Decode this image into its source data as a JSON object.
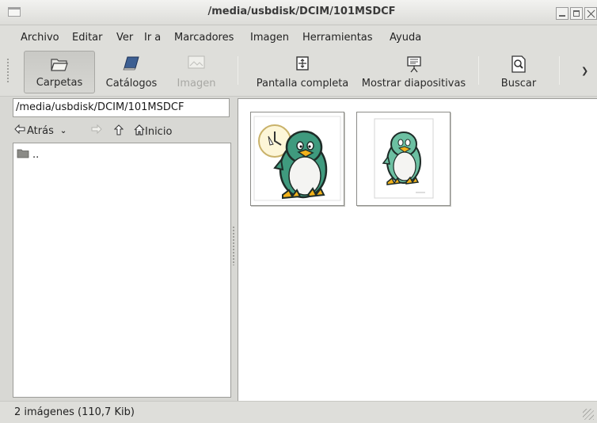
{
  "window": {
    "title": "/media/usbdisk/DCIM/101MSDCF"
  },
  "menu": [
    "Archivo",
    "Editar",
    "Ver",
    "Ir a",
    "Marcadores",
    "Imagen",
    "Herramientas",
    "Ayuda"
  ],
  "toolbar": {
    "folders": "Carpetas",
    "catalogs": "Catálogos",
    "image": "Imagen",
    "fullscreen": "Pantalla completa",
    "slideshow": "Mostrar diapositivas",
    "search": "Buscar"
  },
  "location": {
    "path": "/media/usbdisk/DCIM/101MSDCF"
  },
  "nav": {
    "back": "Atrás",
    "home": "Inicio"
  },
  "folders": [
    {
      "name": ".."
    }
  ],
  "images": [
    {
      "icon": "penguin-with-clock"
    },
    {
      "icon": "penguin"
    }
  ],
  "status": {
    "text": "2 imágenes (110,7 Kib)"
  },
  "colors": {
    "window_bg": "#dededa",
    "content_bg": "#ffffff",
    "penguin_body": "#3f9a7e",
    "penguin_beak": "#f2b21a"
  }
}
